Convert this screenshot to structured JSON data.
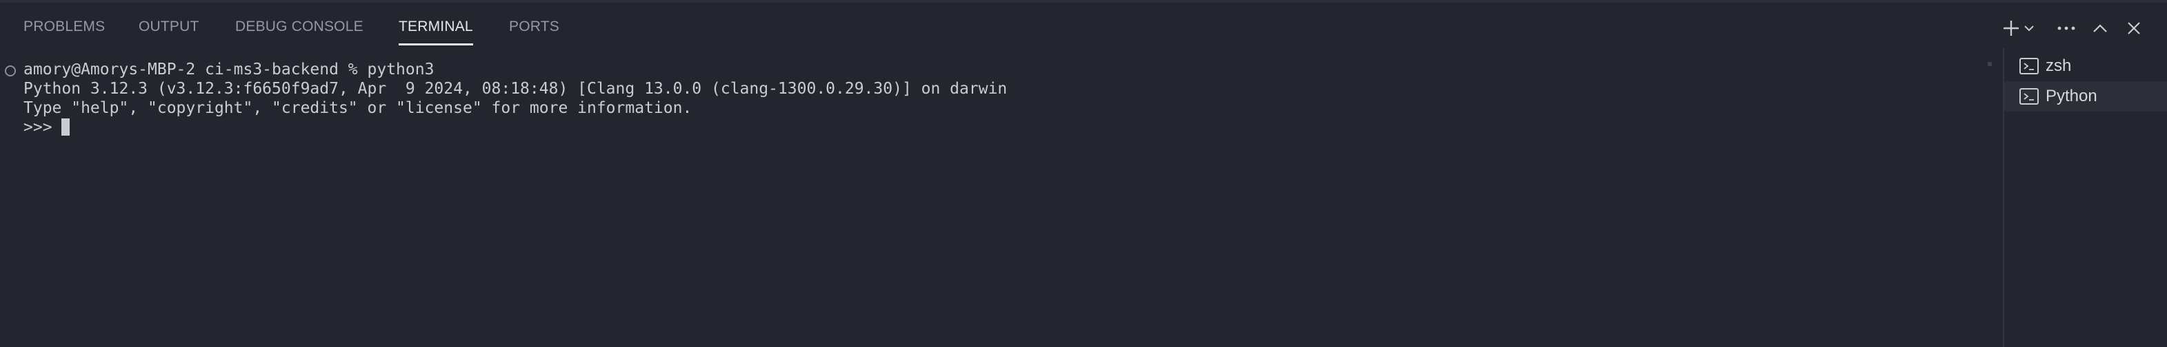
{
  "tabs": [
    {
      "label": "PROBLEMS"
    },
    {
      "label": "OUTPUT"
    },
    {
      "label": "DEBUG CONSOLE"
    },
    {
      "label": "TERMINAL",
      "active": true
    },
    {
      "label": "PORTS"
    }
  ],
  "actions": {
    "new_terminal_icon": "plus-icon",
    "dropdown_icon": "chevron-down-icon",
    "more_icon": "ellipsis-icon",
    "maximize_icon": "chevron-up-icon",
    "close_icon": "close-icon"
  },
  "terminal": {
    "lines": [
      "amory@Amorys-MBP-2 ci-ms3-backend % python3",
      "Python 3.12.3 (v3.12.3:f6650f9ad7, Apr  9 2024, 08:18:48) [Clang 13.0.0 (clang-1300.0.29.30)] on darwin",
      "Type \"help\", \"copyright\", \"credits\" or \"license\" for more information.",
      ">>> "
    ]
  },
  "terminal_list": [
    {
      "label": "zsh",
      "icon": "terminal-icon"
    },
    {
      "label": "Python",
      "icon": "terminal-icon",
      "selected": true
    }
  ],
  "colors": {
    "background": "#23262e",
    "text": "#c9ccd3",
    "tab_inactive": "#9599a3",
    "tab_active": "#e6e8ec",
    "selected_item": "#2c2f37"
  }
}
